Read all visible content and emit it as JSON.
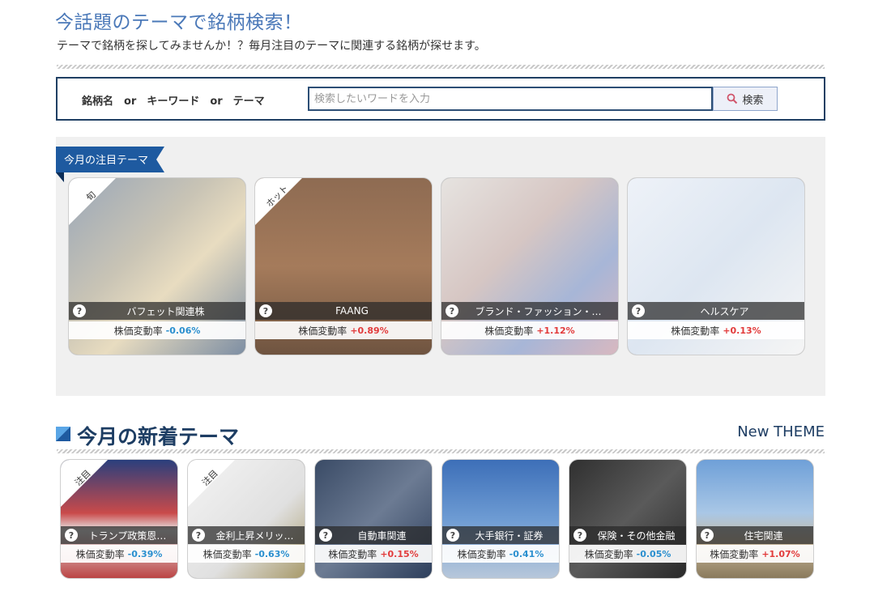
{
  "header": {
    "title": "今話題のテーマで銘柄検索！",
    "subtitle": "テーマで銘柄を探してみませんか！？毎月注目のテーマに関連する銘柄が探せます。"
  },
  "search": {
    "label": "銘柄名　or　キーワード　or　テーマ",
    "placeholder": "検索したいワードを入力",
    "value": "",
    "button_label": "検索"
  },
  "featured": {
    "ribbon_label": "今月の注目テーマ",
    "cards": [
      {
        "name": "バフェット関連株",
        "rate_label": "株価変動率",
        "rate": "-0.06%",
        "direction": "down",
        "tag": "旬"
      },
      {
        "name": "FAANG",
        "rate_label": "株価変動率",
        "rate": "+0.89%",
        "direction": "up",
        "tag": "ホット"
      },
      {
        "name": "ブランド・ファッション・…",
        "rate_label": "株価変動率",
        "rate": "+1.12%",
        "direction": "up",
        "tag": ""
      },
      {
        "name": "ヘルスケア",
        "rate_label": "株価変動率",
        "rate": "+0.13%",
        "direction": "up",
        "tag": ""
      }
    ]
  },
  "new_themes": {
    "title": "今月の新着テーマ",
    "link_label": "New THEME",
    "cards": [
      {
        "name": "トランプ政策恩…",
        "rate_label": "株価変動率",
        "rate": "-0.39%",
        "direction": "down",
        "tag": "注目"
      },
      {
        "name": "金利上昇メリッ…",
        "rate_label": "株価変動率",
        "rate": "-0.63%",
        "direction": "down",
        "tag": "注目"
      },
      {
        "name": "自動車関連",
        "rate_label": "株価変動率",
        "rate": "+0.15%",
        "direction": "up",
        "tag": ""
      },
      {
        "name": "大手銀行・証券",
        "rate_label": "株価変動率",
        "rate": "-0.41%",
        "direction": "down",
        "tag": ""
      },
      {
        "name": "保険・その他金融",
        "rate_label": "株価変動率",
        "rate": "-0.05%",
        "direction": "down",
        "tag": ""
      },
      {
        "name": "住宅関連",
        "rate_label": "株価変動率",
        "rate": "+1.07%",
        "direction": "up",
        "tag": ""
      }
    ]
  },
  "colors": {
    "title_blue": "#4a78b8",
    "navy": "#1d3d63",
    "negative": "#2a8fcf",
    "positive": "#e23b3b"
  }
}
